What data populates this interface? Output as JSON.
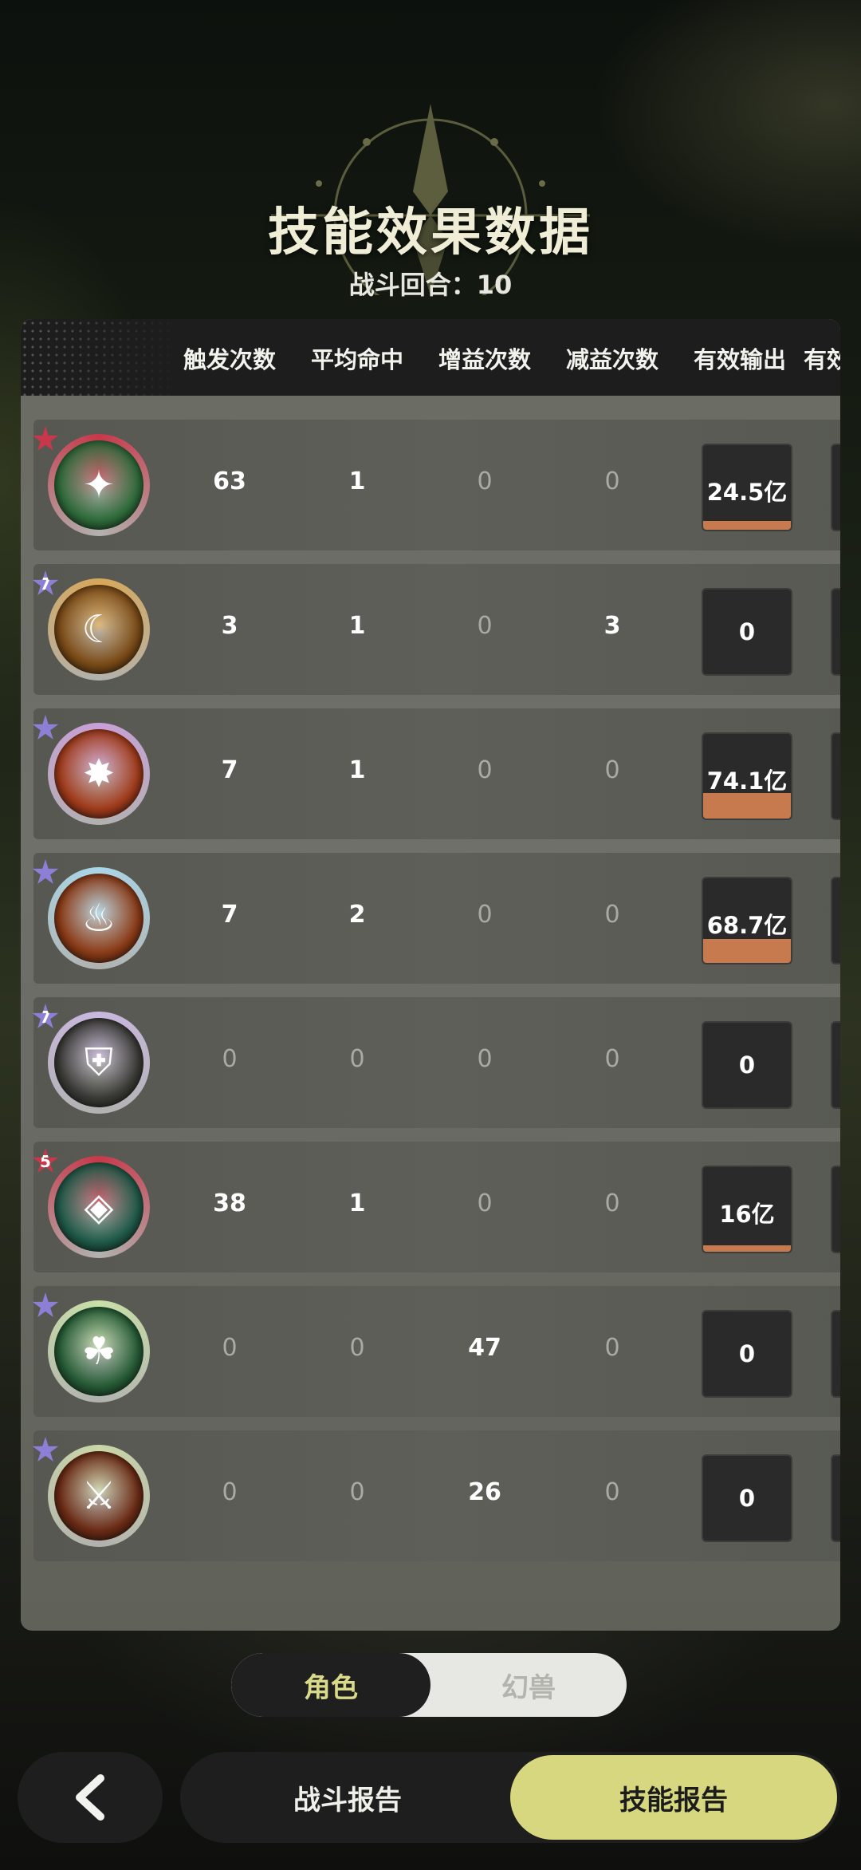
{
  "header": {
    "title": "技能效果数据",
    "rounds": "战斗回合：10"
  },
  "columns": [
    "触发次数",
    "平均命中",
    "增益次数",
    "减益次数",
    "有效输出",
    "有效"
  ],
  "rows": [
    {
      "icon": "green-orbit-skill-icon",
      "badge": "",
      "badge_color": "#c8384a",
      "ring": "#c8384a",
      "inner": "#2e6b3a",
      "glyph": "✦",
      "trigger": "63",
      "avg_hit": "1",
      "buff": "0",
      "debuff": "0",
      "output": "24.5亿",
      "output_fill": 0.1
    },
    {
      "icon": "golden-crescent-skill-icon",
      "badge": "7",
      "badge_color": "#8e7fd6",
      "ring": "#d7a85a",
      "inner": "#7a4a16",
      "glyph": "☾",
      "trigger": "3",
      "avg_hit": "1",
      "buff": "0",
      "debuff": "3",
      "output": "0",
      "output_fill": 0
    },
    {
      "icon": "explosion-skill-icon",
      "badge": "",
      "badge_color": "#8e7fd6",
      "ring": "#c8a0d8",
      "inner": "#a03a1a",
      "glyph": "✸",
      "trigger": "7",
      "avg_hit": "1",
      "buff": "0",
      "debuff": "0",
      "output": "74.1亿",
      "output_fill": 0.3
    },
    {
      "icon": "flame-claw-skill-icon",
      "badge": "",
      "badge_color": "#8e7fd6",
      "ring": "#a9d6e8",
      "inner": "#8a3a16",
      "glyph": "♨",
      "trigger": "7",
      "avg_hit": "2",
      "buff": "0",
      "debuff": "0",
      "output": "68.7亿",
      "output_fill": 0.28
    },
    {
      "icon": "shield-figure-skill-icon",
      "badge": "7",
      "badge_color": "#8e7fd6",
      "ring": "#c9b8e0",
      "inner": "#3a3a36",
      "glyph": "⛨",
      "trigger": "0",
      "avg_hit": "0",
      "buff": "0",
      "debuff": "0",
      "output": "0",
      "output_fill": 0
    },
    {
      "icon": "green-crystal-skill-icon",
      "badge": "5",
      "badge_color": "#c8384a",
      "ring": "#c8384a",
      "inner": "#1f5a48",
      "glyph": "◈",
      "trigger": "38",
      "avg_hit": "1",
      "buff": "0",
      "debuff": "0",
      "output": "16亿",
      "output_fill": 0.06
    },
    {
      "icon": "green-spirit-skill-icon",
      "badge": "",
      "badge_color": "#8e7fd6",
      "ring": "#c9e0a8",
      "inner": "#245a34",
      "glyph": "☘",
      "trigger": "0",
      "avg_hit": "0",
      "buff": "47",
      "debuff": "0",
      "output": "0",
      "output_fill": 0
    },
    {
      "icon": "fire-swords-skill-icon",
      "badge": "",
      "badge_color": "#8e7fd6",
      "ring": "#c9d6a8",
      "inner": "#6a2a14",
      "glyph": "⚔",
      "trigger": "0",
      "avg_hit": "0",
      "buff": "26",
      "debuff": "0",
      "output": "0",
      "output_fill": 0
    }
  ],
  "toggle": {
    "left": "角色",
    "right": "幻兽"
  },
  "nav": {
    "report": "战斗报告",
    "skill": "技能报告"
  }
}
